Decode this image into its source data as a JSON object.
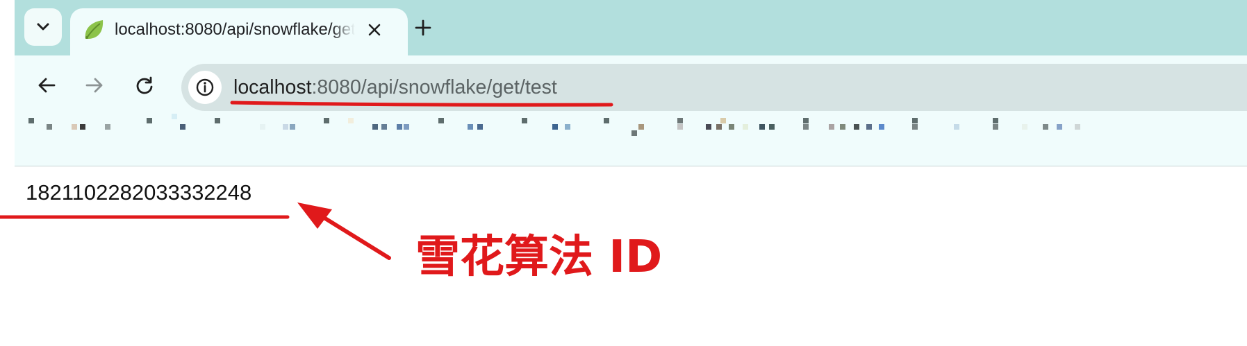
{
  "browser": {
    "tab": {
      "title": "localhost:8080/api/snowflake/get/test",
      "favicon": "spring-leaf-icon"
    },
    "tab_list_icon": "chevron-down-icon",
    "close_icon": "close-icon",
    "new_tab_icon": "plus-icon",
    "nav": {
      "back_icon": "arrow-left-icon",
      "forward_icon": "arrow-right-icon",
      "reload_icon": "reload-icon",
      "site_info_icon": "info-icon"
    },
    "url": {
      "host": "localhost",
      "rest": ":8080/api/snowflake/get/test"
    },
    "colors": {
      "tabbar": "#b2dfdd",
      "toolbar": "#f0fcfc",
      "omnibox": "#d6e3e3"
    }
  },
  "page": {
    "snowflake_id": "1821102282033332248"
  },
  "annotation": {
    "label": "雪花算法 ID",
    "color": "#e0191b"
  }
}
